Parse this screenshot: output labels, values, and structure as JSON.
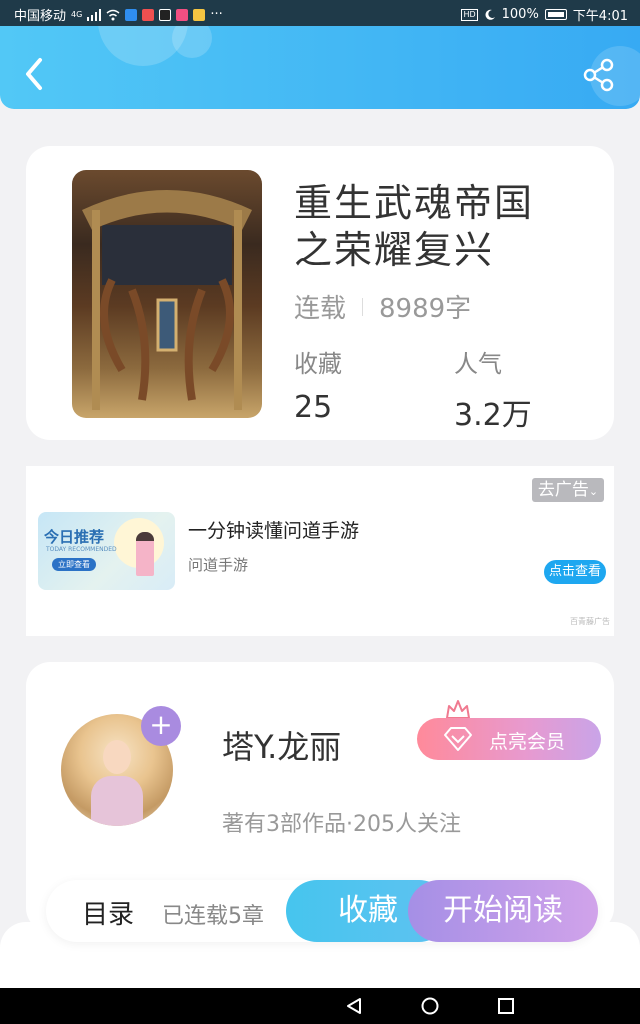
{
  "status_bar": {
    "carrier": "中国移动",
    "signal_label": "4G",
    "battery": "100%",
    "time": "下午4:01",
    "hd": "HD",
    "more": "···"
  },
  "header": {
    "back_icon": "chevron-left-icon",
    "share_icon": "share-icon"
  },
  "book": {
    "title_line1": "重生武魂帝国",
    "title_line2": "之荣耀复兴",
    "status": "连载",
    "word_count": "8989字",
    "favorites_label": "收藏",
    "favorites_value": "25",
    "popularity_label": "人气",
    "popularity_value": "3.2万"
  },
  "ad": {
    "close_label": "去广告",
    "thumb_title": "今日推荐",
    "thumb_subtitle": "TODAY RECOMMENDED",
    "thumb_button": "立即查看",
    "title": "一分钟读懂问道手游",
    "source": "问道手游",
    "view_button": "点击查看",
    "provider": "百青藤广告"
  },
  "author": {
    "name": "塔Y.龙丽",
    "vip_button": "点亮会员",
    "stats": "著有3部作品·205人关注",
    "follow_icon": "plus-icon"
  },
  "action_bar": {
    "toc_label": "目录",
    "chapters_label": "已连载5章",
    "collect_label": "收藏",
    "read_label": "开始阅读"
  },
  "colors": {
    "header_start": "#52c8f6",
    "header_end": "#37aaf3",
    "collect_btn": "#46c5ee",
    "read_btn": "#a58fe6",
    "vip_btn": "#ff8a9a"
  }
}
